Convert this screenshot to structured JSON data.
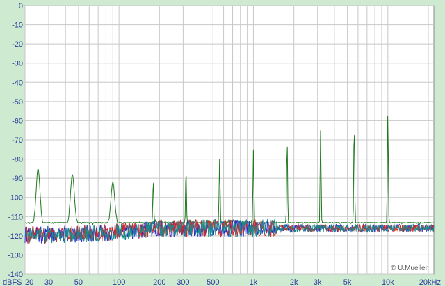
{
  "chart_data": {
    "type": "line",
    "title": "",
    "xlabel": "",
    "ylabel": "",
    "unit_label": "dBFS",
    "x_scale": "log",
    "xlim": [
      20,
      22000
    ],
    "ylim": [
      -140,
      0
    ],
    "grid": true,
    "y_ticks": [
      0,
      -10,
      -20,
      -30,
      -40,
      -50,
      -60,
      -70,
      -80,
      -90,
      -100,
      -110,
      -120,
      -130,
      -140
    ],
    "x_tick_labels": [
      {
        "x": 20,
        "label": "20"
      },
      {
        "x": 30,
        "label": "30"
      },
      {
        "x": 50,
        "label": "50"
      },
      {
        "x": 100,
        "label": "100"
      },
      {
        "x": 200,
        "label": "200"
      },
      {
        "x": 300,
        "label": "300"
      },
      {
        "x": 500,
        "label": "500"
      },
      {
        "x": 1000,
        "label": "1k"
      },
      {
        "x": 2000,
        "label": "2k"
      },
      {
        "x": 3000,
        "label": "3k"
      },
      {
        "x": 5000,
        "label": "5k"
      },
      {
        "x": 10000,
        "label": "10k"
      },
      {
        "x": 20000,
        "label": "20kHz"
      }
    ],
    "x_grid": [
      20,
      30,
      40,
      50,
      60,
      70,
      80,
      90,
      100,
      200,
      300,
      400,
      500,
      600,
      700,
      800,
      900,
      1000,
      2000,
      3000,
      4000,
      5000,
      6000,
      7000,
      8000,
      9000,
      10000,
      20000
    ],
    "noise_floor_db": -114,
    "series": [
      {
        "color": "#1f7a1f",
        "peaks": [
          {
            "x": 25,
            "y": -85
          },
          {
            "x": 45,
            "y": -88
          },
          {
            "x": 90,
            "y": -92
          },
          {
            "x": 180,
            "y": -90
          },
          {
            "x": 315,
            "y": -85
          },
          {
            "x": 560,
            "y": -80
          },
          {
            "x": 1000,
            "y": -75
          },
          {
            "x": 1780,
            "y": -70
          },
          {
            "x": 3160,
            "y": -65
          },
          {
            "x": 5620,
            "y": -61
          },
          {
            "x": 10000,
            "y": -56
          }
        ]
      },
      {
        "color": "#2a2ad0",
        "peaks": []
      },
      {
        "color": "#d02a2a",
        "peaks": []
      },
      {
        "color": "#1a8a8a",
        "peaks": []
      }
    ],
    "copyright": "© U.Mueller"
  }
}
